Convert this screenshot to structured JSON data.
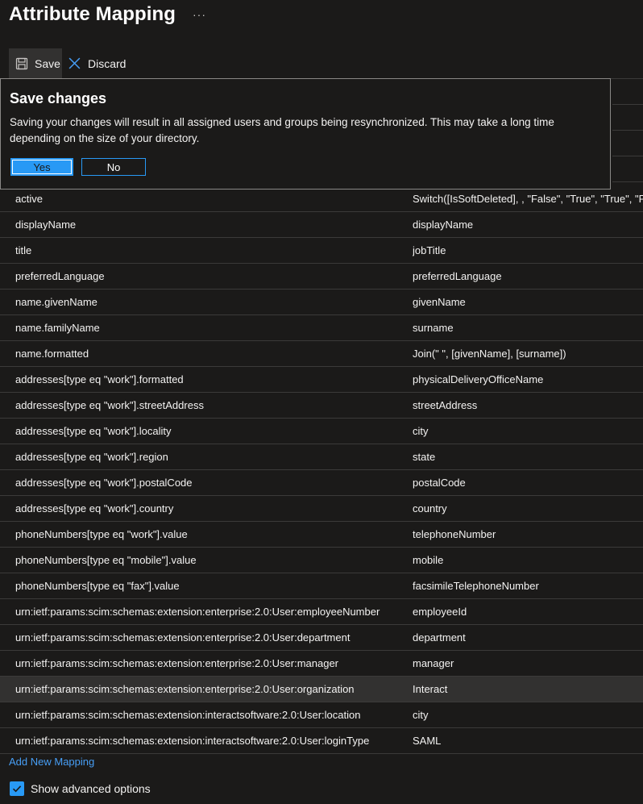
{
  "header": {
    "title": "Attribute Mapping",
    "more": "···"
  },
  "toolbar": {
    "save_label": "Save",
    "discard_label": "Discard"
  },
  "dialog": {
    "title": "Save changes",
    "body": "Saving your changes will result in all assigned users and groups being resynchronized. This may take a long time depending on the size of your directory.",
    "yes_label": "Yes",
    "no_label": "No"
  },
  "mappings": [
    {
      "target": "active",
      "source": "Switch([IsSoftDeleted], , \"False\", \"True\", \"True\", \"False\")"
    },
    {
      "target": "displayName",
      "source": "displayName"
    },
    {
      "target": "title",
      "source": "jobTitle"
    },
    {
      "target": "preferredLanguage",
      "source": "preferredLanguage"
    },
    {
      "target": "name.givenName",
      "source": "givenName"
    },
    {
      "target": "name.familyName",
      "source": "surname"
    },
    {
      "target": "name.formatted",
      "source": "Join(\" \", [givenName], [surname])"
    },
    {
      "target": "addresses[type eq \"work\"].formatted",
      "source": "physicalDeliveryOfficeName"
    },
    {
      "target": "addresses[type eq \"work\"].streetAddress",
      "source": "streetAddress"
    },
    {
      "target": "addresses[type eq \"work\"].locality",
      "source": "city"
    },
    {
      "target": "addresses[type eq \"work\"].region",
      "source": "state"
    },
    {
      "target": "addresses[type eq \"work\"].postalCode",
      "source": "postalCode"
    },
    {
      "target": "addresses[type eq \"work\"].country",
      "source": "country"
    },
    {
      "target": "phoneNumbers[type eq \"work\"].value",
      "source": "telephoneNumber"
    },
    {
      "target": "phoneNumbers[type eq \"mobile\"].value",
      "source": "mobile"
    },
    {
      "target": "phoneNumbers[type eq \"fax\"].value",
      "source": "facsimileTelephoneNumber"
    },
    {
      "target": "urn:ietf:params:scim:schemas:extension:enterprise:2.0:User:employeeNumber",
      "source": "employeeId"
    },
    {
      "target": "urn:ietf:params:scim:schemas:extension:enterprise:2.0:User:department",
      "source": "department"
    },
    {
      "target": "urn:ietf:params:scim:schemas:extension:enterprise:2.0:User:manager",
      "source": "manager"
    },
    {
      "target": "urn:ietf:params:scim:schemas:extension:enterprise:2.0:User:organization",
      "source": "Interact"
    },
    {
      "target": "urn:ietf:params:scim:schemas:extension:interactsoftware:2.0:User:location",
      "source": "city"
    },
    {
      "target": "urn:ietf:params:scim:schemas:extension:interactsoftware:2.0:User:loginType",
      "source": "SAML"
    }
  ],
  "add_mapping_label": "Add New Mapping",
  "advanced": {
    "label": "Show advanced options",
    "checked": true
  },
  "colors": {
    "accent": "#2899f5",
    "link": "#479ef5",
    "background": "#1b1a19"
  }
}
